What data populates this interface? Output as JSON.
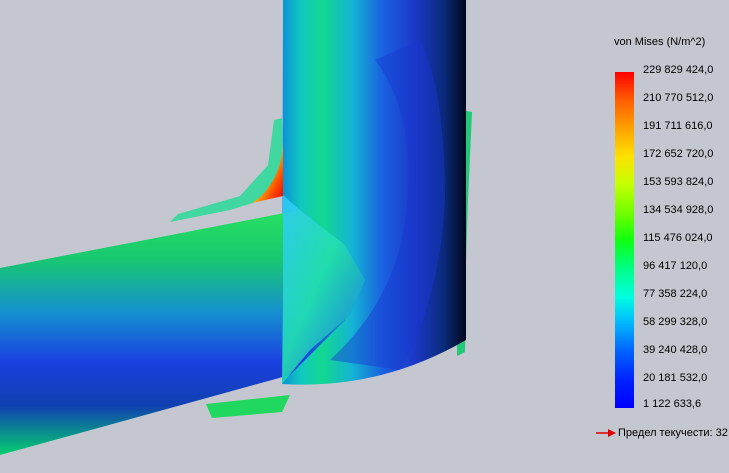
{
  "legend": {
    "title": "von Mises (N/m^2)",
    "ticks": [
      "229 829 424,0",
      "210 770 512,0",
      "191 711 616,0",
      "172 652 720,0",
      "153 593 824,0",
      "134 534 928,0",
      "115 476 024,0",
      "96 417 120,0",
      "77 358 224,0",
      "58 299 328,0",
      "39 240 428,0",
      "20 181 532,0",
      "1 122 633,6"
    ],
    "yield_label": "Предел текучести: 32",
    "yield_arrow_color": "#e00000"
  }
}
